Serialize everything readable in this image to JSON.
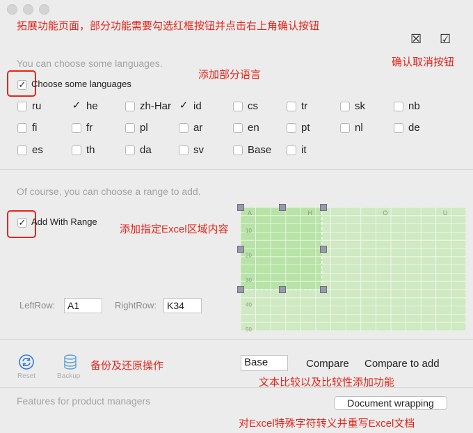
{
  "window": {
    "traffic_lights": [
      "close",
      "minimize",
      "zoom"
    ]
  },
  "annotations": {
    "top_note": "拓展功能页面，部分功能需要勾选红框按钮并点击右上角确认按钮",
    "confirm_cancel": "确认取消按钮",
    "add_languages": "添加部分语言",
    "add_range": "添加指定Excel区域内容",
    "backup_restore": "备份及还原操作",
    "compare_note": "文本比较以及比较性添加功能",
    "escape_note": "对Excel特殊字符转义并重写Excel文档"
  },
  "header": {
    "cancel_glyph": "☒",
    "confirm_glyph": "☑"
  },
  "languages": {
    "hint": "You can choose some languages.",
    "master_label": "Choose some languages",
    "master_checked": true,
    "items": [
      {
        "label": "ru",
        "checked": false
      },
      {
        "label": "he",
        "checked": true
      },
      {
        "label": "zh-Har",
        "checked": false
      },
      {
        "label": "id",
        "checked": true
      },
      {
        "label": "cs",
        "checked": false
      },
      {
        "label": "tr",
        "checked": false
      },
      {
        "label": "sk",
        "checked": false
      },
      {
        "label": "nb",
        "checked": false
      },
      {
        "label": "fi",
        "checked": false
      },
      {
        "label": "fr",
        "checked": false
      },
      {
        "label": "pl",
        "checked": false
      },
      {
        "label": "ar",
        "checked": false
      },
      {
        "label": "en",
        "checked": false
      },
      {
        "label": "pt",
        "checked": false
      },
      {
        "label": "nl",
        "checked": false
      },
      {
        "label": "de",
        "checked": false
      },
      {
        "label": "es",
        "checked": false
      },
      {
        "label": "th",
        "checked": false
      },
      {
        "label": "da",
        "checked": false
      },
      {
        "label": "sv",
        "checked": false
      },
      {
        "label": "Base",
        "checked": false
      },
      {
        "label": "it",
        "checked": false
      }
    ]
  },
  "range": {
    "hint": "Of course, you can choose a range to add.",
    "master_label": "Add With Range",
    "master_checked": true,
    "left_label": "LeftRow:",
    "left_value": "A1",
    "right_label": "RightRow:",
    "right_value": "K34",
    "grid": {
      "col_labels": [
        {
          "text": "A",
          "col": 0
        },
        {
          "text": "H",
          "col": 4
        },
        {
          "text": "O",
          "col": 9
        },
        {
          "text": "U",
          "col": 13
        }
      ],
      "row_labels": [
        "10",
        "20",
        "30",
        "40",
        "50"
      ]
    }
  },
  "actions": {
    "reset_label": "Reset",
    "backup_label": "Backup",
    "compare_field": "Base",
    "compare_label": "Compare",
    "compare_add_label": "Compare to add"
  },
  "footer": {
    "hint": "Features for product managers",
    "doc_button": "Document wrapping"
  },
  "colors": {
    "annotation": "#e3261c",
    "grid_bg": "#cfe9c2",
    "grid_selection": "#b7e3a6",
    "reset_icon": "#2f7ae5",
    "backup_icon": "#5a9fd6"
  }
}
